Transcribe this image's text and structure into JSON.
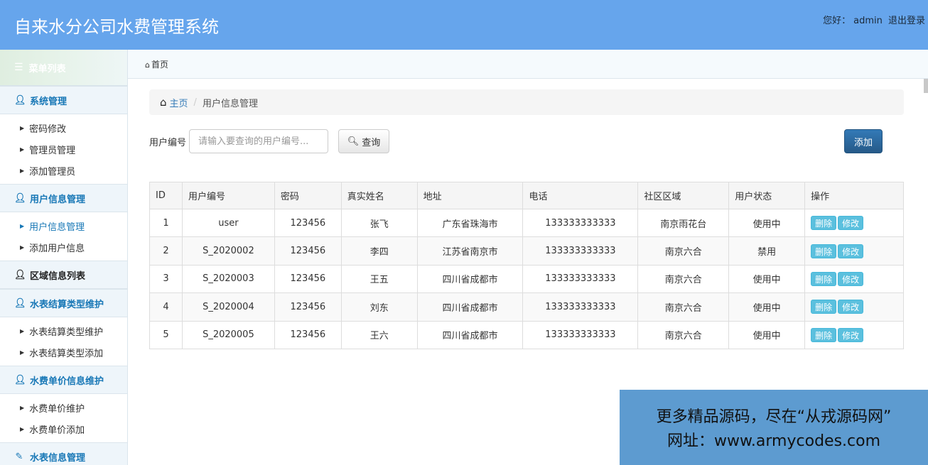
{
  "header": {
    "title": "自来水分公司水费管理系统",
    "greeting": "您好：",
    "username": "admin",
    "logout": "退出登录"
  },
  "sidebar": {
    "menu_title": "菜单列表",
    "groups": [
      {
        "label": "系统管理",
        "items": [
          "密码修改",
          "管理员管理",
          "添加管理员"
        ]
      },
      {
        "label": "用户信息管理",
        "items": [
          "用户信息管理",
          "添加用户信息"
        ]
      },
      {
        "label": "区域信息列表",
        "items": []
      },
      {
        "label": "水表结算类型维护",
        "items": [
          "水表结算类型维护",
          "水表结算类型添加"
        ]
      },
      {
        "label": "水费单价信息维护",
        "items": [
          "水费单价维护",
          "水费单价添加"
        ]
      },
      {
        "label": "水表信息管理",
        "items": []
      }
    ]
  },
  "tabbar": {
    "home": "首页"
  },
  "breadcrumb": {
    "home": "主页",
    "current": "用户信息管理"
  },
  "search": {
    "label": "用户编号",
    "placeholder": "请输入要查询的用户编号...",
    "query_label": "查询",
    "add_label": "添加"
  },
  "table": {
    "headers": [
      "ID",
      "用户编号",
      "密码",
      "真实姓名",
      "地址",
      "电话",
      "社区区域",
      "用户状态",
      "操作"
    ],
    "delete_label": "删除",
    "edit_label": "修改",
    "rows": [
      {
        "id": "1",
        "code": "user",
        "password": "123456",
        "name": "张飞",
        "address": "广东省珠海市",
        "phone": "133333333333",
        "area": "南京雨花台",
        "status": "使用中"
      },
      {
        "id": "2",
        "code": "S_2020002",
        "password": "123456",
        "name": "李四",
        "address": "江苏省南京市",
        "phone": "133333333333",
        "area": "南京六合",
        "status": "禁用"
      },
      {
        "id": "3",
        "code": "S_2020003",
        "password": "123456",
        "name": "王五",
        "address": "四川省成都市",
        "phone": "133333333333",
        "area": "南京六合",
        "status": "使用中"
      },
      {
        "id": "4",
        "code": "S_2020004",
        "password": "123456",
        "name": "刘东",
        "address": "四川省成都市",
        "phone": "133333333333",
        "area": "南京六合",
        "status": "使用中"
      },
      {
        "id": "5",
        "code": "S_2020005",
        "password": "123456",
        "name": "王六",
        "address": "四川省成都市",
        "phone": "133333333333",
        "area": "南京六合",
        "status": "使用中"
      }
    ]
  },
  "watermark": {
    "line1": "更多精品源码，尽在“从戎源码网”",
    "line2": "网址：www.armycodes.com"
  },
  "colors": {
    "header_bg": "#66a5ec",
    "accent": "#1777b6",
    "primary_button": "#337ab7",
    "info_button": "#5bc0de"
  }
}
